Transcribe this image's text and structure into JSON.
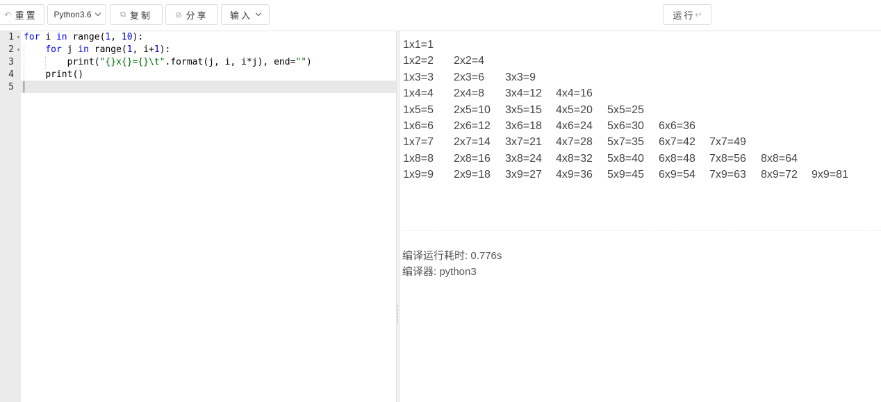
{
  "toolbar": {
    "reset_label": "重置",
    "language_label": "Python3.6",
    "copy_label": "复制",
    "share_label": "分享",
    "input_label": "输入",
    "run_label": "运行",
    "icons": {
      "reset": "undo-icon",
      "copy": "copy-icon",
      "share": "link-icon",
      "run": "return-arrow-icon"
    }
  },
  "editor": {
    "line_numbers": [
      "1",
      "2",
      "3",
      "4",
      "5"
    ],
    "lines": [
      "for i in range(1, 10):",
      "    for j in range(1, i+1):",
      "        print(\"{}x{}={}\\t\".format(j, i, i*j), end=\"\")",
      "    print()",
      ""
    ],
    "active_line": 5
  },
  "output": {
    "rows": [
      [
        "1x1=1"
      ],
      [
        "1x2=2",
        "2x2=4"
      ],
      [
        "1x3=3",
        "2x3=6",
        "3x3=9"
      ],
      [
        "1x4=4",
        "2x4=8",
        "3x4=12",
        "4x4=16"
      ],
      [
        "1x5=5",
        "2x5=10",
        "3x5=15",
        "4x5=20",
        "5x5=25"
      ],
      [
        "1x6=6",
        "2x6=12",
        "3x6=18",
        "4x6=24",
        "5x6=30",
        "6x6=36"
      ],
      [
        "1x7=7",
        "2x7=14",
        "3x7=21",
        "4x7=28",
        "5x7=35",
        "6x7=42",
        "7x7=49"
      ],
      [
        "1x8=8",
        "2x8=16",
        "3x8=24",
        "4x8=32",
        "5x8=40",
        "6x8=48",
        "7x8=56",
        "8x8=64"
      ],
      [
        "1x9=9",
        "2x9=18",
        "3x9=27",
        "4x9=36",
        "5x9=45",
        "6x9=54",
        "7x9=63",
        "8x9=72",
        "9x9=81"
      ]
    ],
    "elapsed": "编译运行耗时: 0.776s",
    "compiler": "编译器: python3"
  }
}
